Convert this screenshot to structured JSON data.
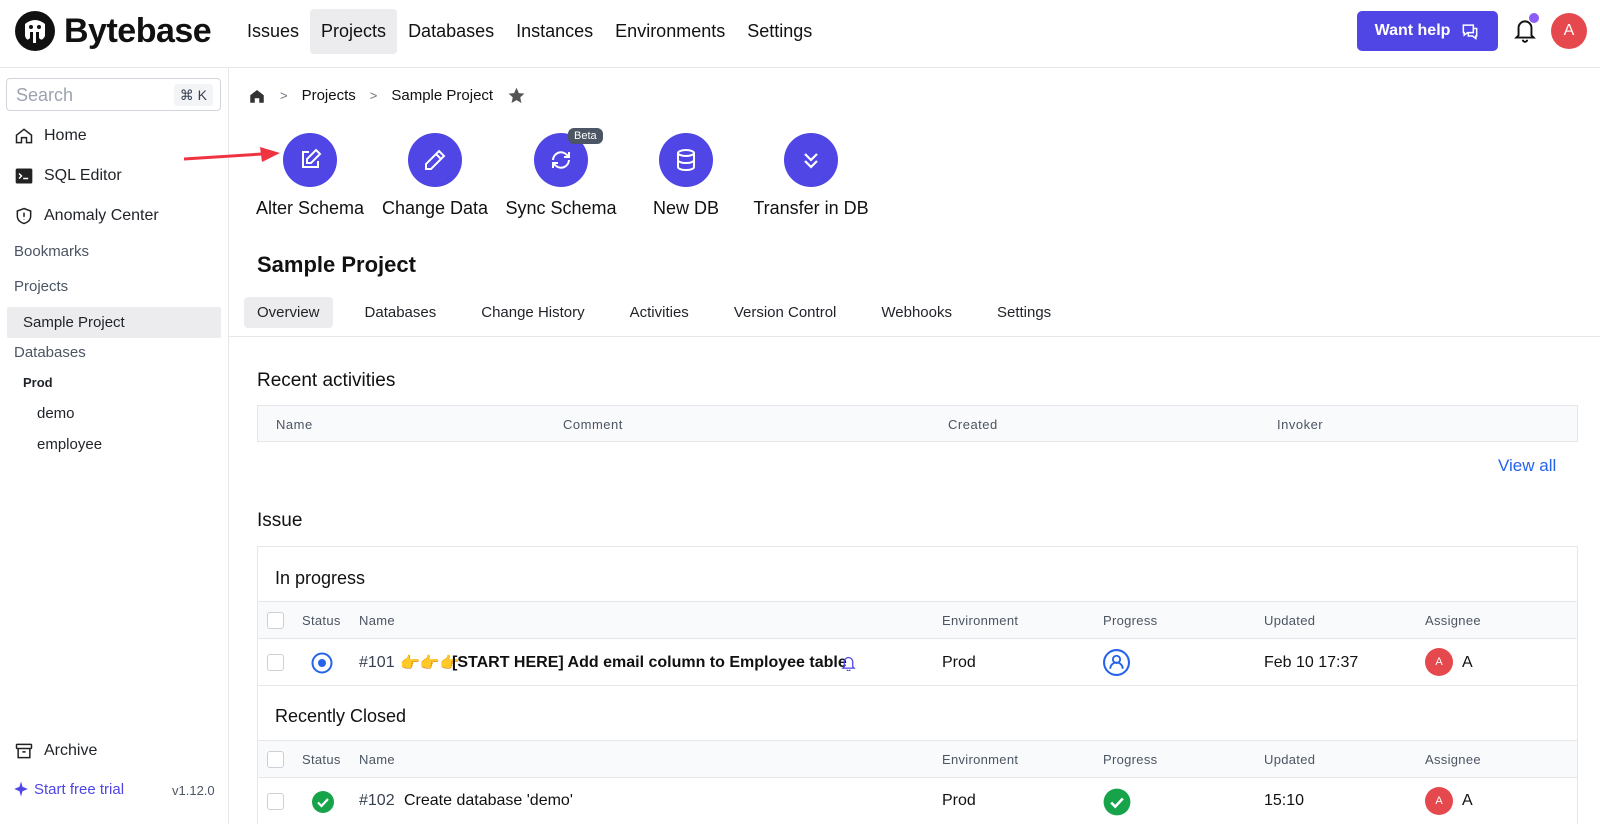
{
  "app": {
    "name": "Bytebase"
  },
  "nav": {
    "items": [
      "Issues",
      "Projects",
      "Databases",
      "Instances",
      "Environments",
      "Settings"
    ],
    "active": "Projects"
  },
  "header": {
    "help_label": "Want help",
    "avatar_initial": "A"
  },
  "sidebar": {
    "search_placeholder": "Search",
    "search_shortcut": "⌘ K",
    "home": "Home",
    "sql_editor": "SQL Editor",
    "anomaly_center": "Anomaly Center",
    "bookmarks": "Bookmarks",
    "projects_section": "Projects",
    "project_item": "Sample Project",
    "databases_section": "Databases",
    "env": "Prod",
    "dbs": [
      "demo",
      "employee"
    ],
    "archive": "Archive",
    "trial": "Start free trial",
    "version": "v1.12.0"
  },
  "breadcrumb": {
    "projects": "Projects",
    "current": "Sample Project"
  },
  "quick_actions": {
    "alter_schema": "Alter Schema",
    "change_data": "Change Data",
    "sync_schema": "Sync Schema",
    "new_db": "New DB",
    "transfer_db": "Transfer in DB",
    "beta_badge": "Beta"
  },
  "project": {
    "title": "Sample Project"
  },
  "tabs": [
    "Overview",
    "Databases",
    "Change History",
    "Activities",
    "Version Control",
    "Webhooks",
    "Settings"
  ],
  "activities": {
    "title": "Recent activities",
    "columns": [
      "Name",
      "Comment",
      "Created",
      "Invoker"
    ],
    "view_all": "View all"
  },
  "issues": {
    "title": "Issue",
    "in_progress_title": "In progress",
    "closed_title": "Recently Closed",
    "columns": [
      "Status",
      "Name",
      "Environment",
      "Progress",
      "Updated",
      "Assignee"
    ],
    "in_progress": [
      {
        "id": "#101",
        "emoji": "👉👉👉",
        "title": "[START HERE] Add email column to Employee table",
        "environment": "Prod",
        "updated": "Feb 10 17:37",
        "assignee_initial": "A",
        "assignee": "A"
      }
    ],
    "closed": [
      {
        "id": "#102",
        "title": "Create database 'demo'",
        "environment": "Prod",
        "updated": "15:10",
        "assignee_initial": "A",
        "assignee": "A"
      }
    ]
  },
  "colors": {
    "accent": "#4f46e5",
    "success": "#16a34a",
    "danger": "#e5484d",
    "link": "#2563eb"
  }
}
